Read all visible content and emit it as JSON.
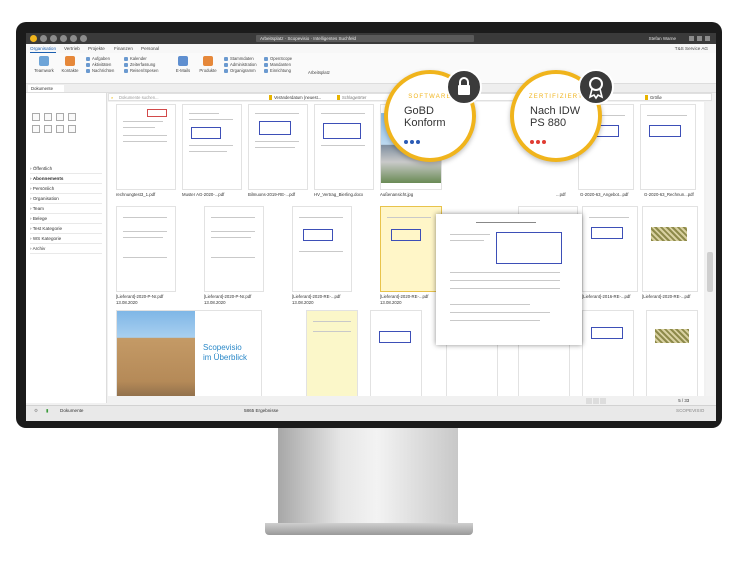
{
  "app": {
    "search_title": "Arbeitsplatz · Scopevisio · Intelligentes Suchfeld",
    "user": "Stefan Warne",
    "company": "T&S Service AG"
  },
  "menu": [
    "Organisation",
    "Vertrieb",
    "Projekte",
    "Finanzen",
    "Personal"
  ],
  "ribbon": {
    "big": [
      "Teamwork",
      "Kontakte",
      "E-Mails",
      "Produkte"
    ],
    "col1": [
      "Aufgaben",
      "Aktivitäten",
      "Nachrichten"
    ],
    "col2": [
      "Kalender",
      "Zeiterfassung",
      "Reisen/Spesen"
    ],
    "col3": [
      "Stammdaten",
      "Administration",
      "Organigramm"
    ],
    "col4": [
      "OpenScope",
      "Mandanten",
      "Einrichtung"
    ],
    "workspace": "Arbeitsplatz"
  },
  "tab": "Dokumente",
  "search": {
    "placeholder": "Dokumente suchen...",
    "filters": [
      "Veränderdatum (neuest...",
      "Schlagwörter",
      "Größe"
    ]
  },
  "sidebar": {
    "items": [
      "Öffentlich",
      "Abonnements",
      "Persönlich",
      "Organisation",
      "Team",
      "Belege",
      "Test Kategorie",
      "WS Kategorie",
      "Archiv"
    ]
  },
  "documents": {
    "row1": [
      "rechnungtest3_1.pdf",
      "Muster AG-2020-...pdf",
      "Bilmuons-2019-RE-...pdf",
      "HV_Vertrag_Bierling.docx",
      "Außenansicht.jpg",
      "",
      "",
      "...pdf",
      "G-2020-63_Angebot...pdf",
      "G-2020-63_Rechnun...pdf"
    ],
    "row2": [
      "[Lieferant]-2020-P-Nr.pdf",
      "[Lieferant]-2020-P-Nr.pdf",
      "[Lieferant]-2020-RE-...pdf",
      "[Lieferant]-2020-RE-...pdf",
      "[Lieferant]-2020-RE-...pdf",
      "[Lieferant]-2016-RE-...pdf",
      "[Lieferant]-2020-RE-...pdf"
    ],
    "row2_dates": [
      "13.08.2020",
      "13.08.2020",
      "13.08.2020",
      "13.08.2020"
    ],
    "promo": [
      "Scopevisio",
      "im Überblick"
    ]
  },
  "pager": {
    "page": "5",
    "total": "/ 33"
  },
  "status": {
    "left": "Dokumente",
    "results": "5865 Ergebnisse",
    "right": "SCOPEVISIO"
  },
  "badges": [
    {
      "head": "SOFTWARE",
      "line1": "GoBD",
      "line2": "Konform",
      "icon": "lock-icon"
    },
    {
      "head": "ZERTIFIZIERT",
      "line1": "Nach IDW",
      "line2": "PS 880",
      "icon": "award-icon"
    }
  ],
  "colors": {
    "accent": "#f0b41c",
    "blue": "#1c5fb0",
    "dot1": "#2b5bb5",
    "dot2": "#e03c32"
  }
}
